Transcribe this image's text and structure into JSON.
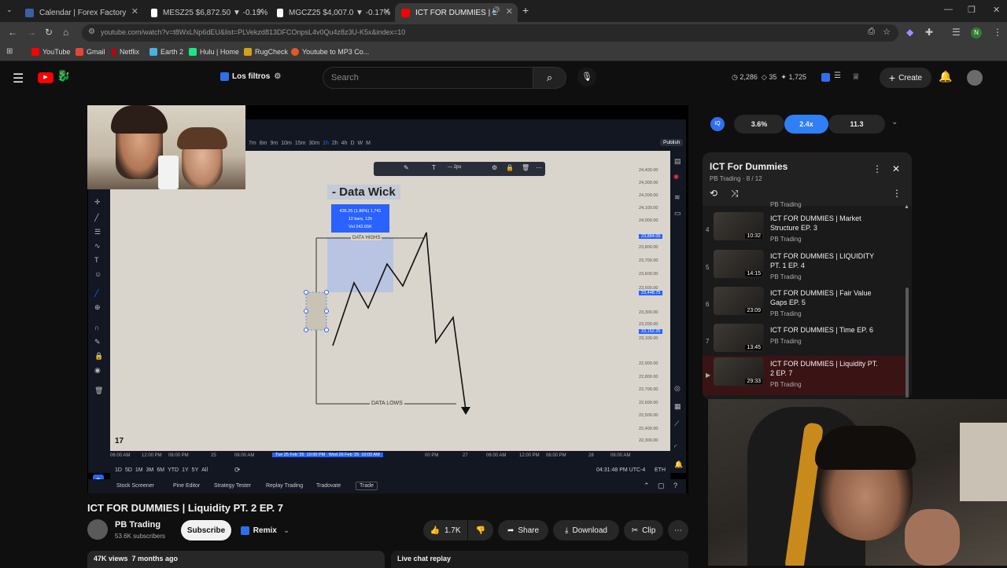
{
  "browser": {
    "tabs": [
      {
        "label": "Calendar | Forex Factory",
        "color": "#3b5fa0"
      },
      {
        "label": "MESZ25 $6,872.50 ▼ -0.15%",
        "color": "#ffffff"
      },
      {
        "label": "MGCZ25 $4,007.0 ▼ -0.17%",
        "color": "#ffffff"
      },
      {
        "label": "ICT FOR DUMMIES | Liquidi",
        "color": "#ff0000"
      }
    ],
    "url": "youtube.com/watch?v=t8WxLNp6dEU&list=PLVekzd813DFCOnpsL4v0Qu4z8z3U-K5x&index=10",
    "profile_initial": "N",
    "bookmarks": [
      "YouTube",
      "Gmail",
      "Netflix",
      "Earth 2",
      "Hulu | Home",
      "RugCheck",
      "Youtube to MP3 Co..."
    ]
  },
  "youtube": {
    "filters_label": "Los filtros",
    "search_placeholder": "Search",
    "stats": [
      "2,286",
      "35",
      "1,725"
    ],
    "create_label": "Create",
    "sponsor": [
      "3.6%",
      "2.4x",
      "11.3"
    ]
  },
  "video": {
    "title": "ICT FOR DUMMIES | Liquidity PT. 2 EP. 7",
    "channel": "PB Trading",
    "subscribers": "53.6K subscribers",
    "subscribe_label": "Subscribe",
    "remix_label": "Remix",
    "likes": "1.7K",
    "share_label": "Share",
    "download_label": "Download",
    "clip_label": "Clip",
    "views_meta": "47K views  7 months ago",
    "live_chat": "Live chat replay"
  },
  "chart": {
    "heading": "- Data Wick",
    "highs_label": "DATA HIGHS",
    "lows_label": "DATA LOWS",
    "tooltip": [
      "435.25 (1.86%) 1,741",
      "12 bars, 12h",
      "Vol 242.65K"
    ],
    "publish": "Publish",
    "timeframes": [
      "7m",
      "8m",
      "9m",
      "10m",
      "15m",
      "30m",
      "1h",
      "2h",
      "4h",
      "D",
      "W",
      "M"
    ],
    "prices": [
      "24,400.00",
      "24,300.00",
      "24,200.00",
      "24,100.00",
      "24,000.00",
      "23,884.00",
      "23,800.00",
      "23,700.00",
      "23,600.00",
      "23,500.00",
      "23,448.75",
      "23,300.00",
      "23,200.00",
      "23,152.25",
      "23,100.00",
      "22,900.00",
      "22,800.00",
      "22,700.00",
      "22,600.00",
      "22,500.00",
      "22,400.00",
      "22,300.00"
    ],
    "times": [
      "06:00 AM",
      "12:00 PM",
      "06:00 PM",
      "25",
      "06:00 AM",
      "00 PM",
      "27",
      "06:00 AM",
      "12:00 PM",
      "06:00 PM",
      "28",
      "06:00 AM"
    ],
    "time_range": "Tue 25 Feb '25  10:00 PM   Wed 26 Feb '25  10:00 AM",
    "ranges": [
      "1D",
      "5D",
      "1M",
      "3M",
      "6M",
      "YTD",
      "1Y",
      "5Y",
      "All"
    ],
    "clock": "04:31:48 PM UTC-4",
    "session": "ETH",
    "panels": [
      "Stock Screener",
      "Pine Editor",
      "Strategy Tester",
      "Replay Trading",
      "Tradovate",
      "Trade"
    ]
  },
  "playlist": {
    "title": "ICT For Dummies",
    "subtitle": "PB Trading · 8 / 12",
    "top_channel": "PB Trading",
    "items": [
      {
        "num": "4",
        "title": "ICT FOR DUMMIES | Market Structure EP. 3",
        "duration": "10:32",
        "channel": "PB Trading"
      },
      {
        "num": "5",
        "title": "ICT FOR DUMMIES | LIQUIDITY PT. 1 EP. 4",
        "duration": "14:15",
        "channel": "PB Trading"
      },
      {
        "num": "6",
        "title": "ICT FOR DUMMIES | Fair Value Gaps EP. 5",
        "duration": "23:09",
        "channel": "PB Trading"
      },
      {
        "num": "7",
        "title": "ICT FOR DUMMIES | Time EP. 6",
        "duration": "13:45",
        "channel": "PB Trading"
      },
      {
        "num": "▶",
        "title": "ICT FOR DUMMIES | Liquidity PT. 2 EP. 7",
        "duration": "29:33",
        "channel": "PB Trading"
      }
    ]
  }
}
